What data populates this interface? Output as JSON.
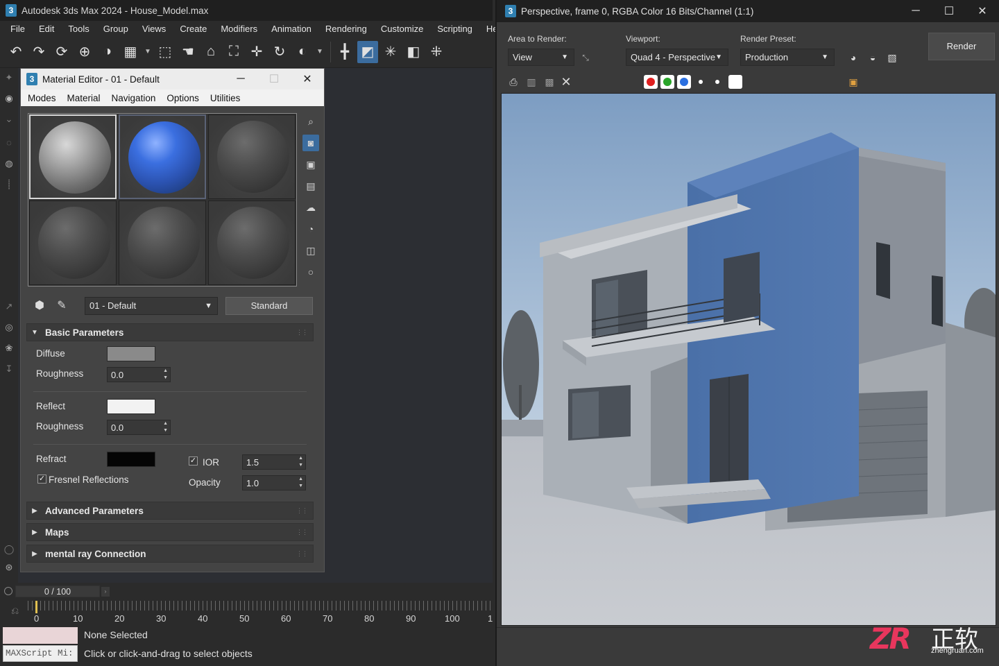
{
  "main": {
    "title": "Autodesk 3ds Max 2024 - House_Model.max",
    "menu": [
      "File",
      "Edit",
      "Tools",
      "Group",
      "Views",
      "Create",
      "Modifiers",
      "Animation",
      "Rendering",
      "Customize",
      "Scripting",
      "Help"
    ]
  },
  "material_editor": {
    "title": "Material Editor - 01 - Default",
    "menu": [
      "Modes",
      "Material",
      "Navigation",
      "Options",
      "Utilities"
    ],
    "material_name": "01 - Default",
    "material_type": "Standard",
    "basic": {
      "header": "Basic Parameters",
      "diffuse_label": "Diffuse",
      "diffuse_color": "#8a8a8a",
      "roughness_label": "Roughness",
      "roughness_value": "0.0",
      "reflect_label": "Reflect",
      "reflect_color": "#f2f2f2",
      "roughness2_label": "Roughness",
      "roughness2_value": "0.0",
      "refract_label": "Refract",
      "refract_color": "#050505",
      "ior_label": "IOR",
      "ior_value": "1.5",
      "fresnel_label": "Fresnel Reflections",
      "opacity_label": "Opacity",
      "opacity_value": "1.0"
    },
    "rollouts": [
      "Advanced Parameters",
      "Maps",
      "mental ray Connection"
    ]
  },
  "timeline": {
    "slider": "0 / 100",
    "ticks": [
      "0",
      "10",
      "20",
      "30",
      "40",
      "50",
      "60",
      "70",
      "80",
      "90",
      "100",
      "1"
    ]
  },
  "status": {
    "maxscript": "MAXScript Mi:",
    "line1": "None Selected",
    "line2": "Click or click-and-drag to select objects"
  },
  "render_window": {
    "title": "Perspective, frame 0, RGBA Color 16 Bits/Channel (1:1)",
    "area_label": "Area to Render:",
    "area_value": "View",
    "viewport_label": "Viewport:",
    "viewport_value": "Quad 4 - Perspective",
    "preset_label": "Render Preset:",
    "preset_value": "Production",
    "render_button": "Render",
    "channel_colors": [
      "#e02020",
      "#2aa52a",
      "#2a6fe0"
    ]
  },
  "watermark": {
    "logo": "ZR",
    "cn": "正软",
    "url": "zhengruan.com"
  }
}
